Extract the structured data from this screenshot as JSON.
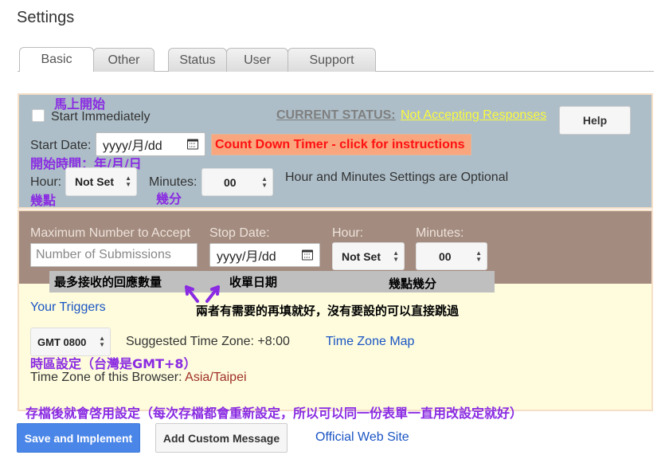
{
  "page": {
    "title": "Settings"
  },
  "tabs": [
    {
      "label": "Basic",
      "active": true
    },
    {
      "label": "Other"
    },
    {
      "label": "Status"
    },
    {
      "label": "User"
    },
    {
      "label": "Support"
    }
  ],
  "status_panel": {
    "annotation_start": "馬上開始",
    "start_immediately_label": "Start Immediately",
    "current_status_label": "CURRENT STATUS:",
    "current_status_value": "Not Accepting Responses",
    "help_label": "Help",
    "start_date_label": "Start Date:",
    "start_date_value": "yyyy/月/dd",
    "countdown_label": "Count Down Timer - click for instructions",
    "annotation_start_time": "開始時間：年/月/日",
    "hour_label": "Hour:",
    "hour_value": "Not Set",
    "minutes_label": "Minutes:",
    "minutes_value": "00",
    "optional_note": "Hour and Minutes Settings are Optional",
    "annotation_hour": "幾點",
    "annotation_minute": "幾分"
  },
  "limit_panel": {
    "max_label": "Maximum Number to Accept",
    "max_placeholder": "Number of Submissions",
    "stop_date_label": "Stop Date:",
    "stop_date_value": "yyyy/月/dd",
    "hour_label": "Hour:",
    "hour_value": "Not Set",
    "minutes_label": "Minutes:",
    "minutes_value": "00",
    "annotation_max": "最多接收的回應數量",
    "annotation_stop": "收單日期",
    "annotation_time": "幾點幾分",
    "annotation_optional": "兩者有需要的再填就好，沒有要設的可以直接跳過"
  },
  "tz_panel": {
    "triggers_link": "Your Triggers",
    "tz_value": "GMT 0800",
    "suggested_label": "Suggested Time Zone: +8:00",
    "tz_map_link": "Time Zone Map",
    "annotation_tz": "時區設定（台灣是GMT+8）",
    "browser_tz_label": "Time Zone of this Browser: ",
    "browser_tz_value": "Asia/Taipei",
    "annotation_save": "存檔後就會啓用設定（每次存檔都會重新設定，所以可以同一份表單一直用改設定就好）"
  },
  "footer": {
    "save_label": "Save and Implement",
    "custom_label": "Add Custom Message",
    "official_link": "Official Web Site"
  },
  "colors": {
    "status_panel": "#adbec8",
    "limit_panel": "#a38b7f",
    "tz_panel": "#fefcdd",
    "annotation": "#8a2be2",
    "save_button": "#4a86e8",
    "status_value": "#fbfb3b",
    "countdown_text": "#ff1111"
  }
}
